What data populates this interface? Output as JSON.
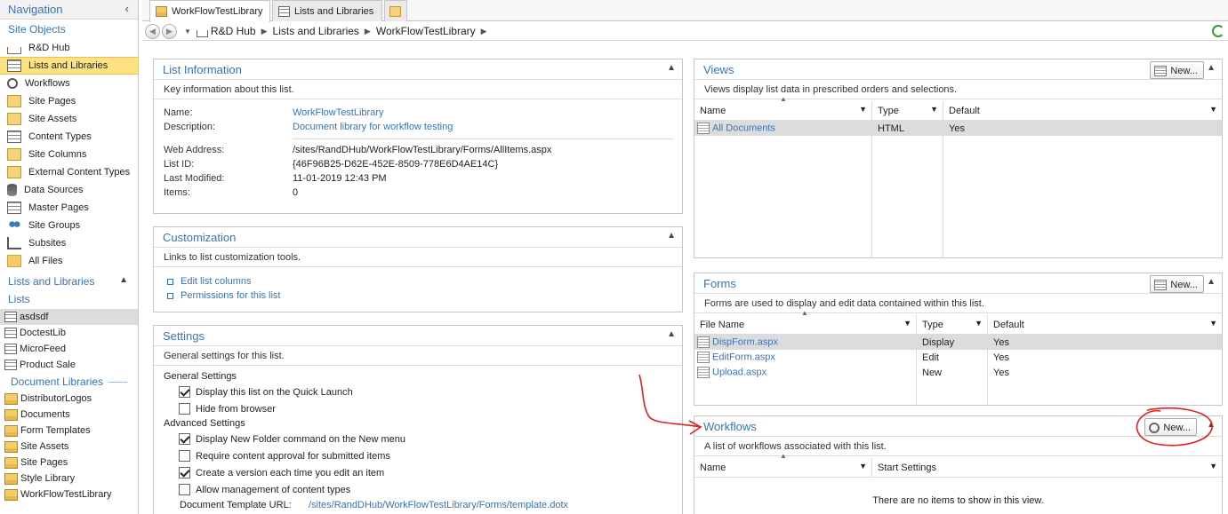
{
  "nav": {
    "title": "Navigation",
    "site_objects_title": "Site Objects",
    "site_objects": [
      {
        "label": "R&D Hub",
        "icon": "house-icon"
      },
      {
        "label": "Lists and Libraries",
        "icon": "list-icon",
        "selected": true
      },
      {
        "label": "Workflows",
        "icon": "workflow-icon"
      },
      {
        "label": "Site Pages",
        "icon": "page-icon"
      },
      {
        "label": "Site Assets",
        "icon": "page-icon"
      },
      {
        "label": "Content Types",
        "icon": "list-icon"
      },
      {
        "label": "Site Columns",
        "icon": "page-icon"
      },
      {
        "label": "External Content Types",
        "icon": "page-icon"
      },
      {
        "label": "Data Sources",
        "icon": "database-icon"
      },
      {
        "label": "Master Pages",
        "icon": "list-icon"
      },
      {
        "label": "Site Groups",
        "icon": "people-icon"
      },
      {
        "label": "Subsites",
        "icon": "tree-icon"
      },
      {
        "label": "All Files",
        "icon": "folder-icon"
      }
    ],
    "lists_libraries_title": "Lists and Libraries",
    "lists_title": "Lists",
    "lists": [
      "asdsdf",
      "DoctestLib",
      "MicroFeed",
      "Product Sale"
    ],
    "doclibs_title": "Document Libraries",
    "doclibs": [
      "DistributorLogos",
      "Documents",
      "Form Templates",
      "Site Assets",
      "Site Pages",
      "Style Library",
      "WorkFlowTestLibrary"
    ]
  },
  "tabs": [
    {
      "label": "WorkFlowTestLibrary",
      "active": true
    },
    {
      "label": "Lists and Libraries",
      "active": false
    }
  ],
  "breadcrumb": [
    "R&D Hub",
    "Lists and Libraries",
    "WorkFlowTestLibrary"
  ],
  "list_info": {
    "title": "List Information",
    "desc": "Key information about this list.",
    "name_label": "Name:",
    "name_value": "WorkFlowTestLibrary",
    "description_label": "Description:",
    "description_value": "Document library for workflow testing",
    "web_address_label": "Web Address:",
    "web_address_value": "/sites/RandDHub/WorkFlowTestLibrary/Forms/AllItems.aspx",
    "list_id_label": "List ID:",
    "list_id_value": "{46F96B25-D62E-452E-8509-778E6D4AE14C}",
    "last_modified_label": "Last Modified:",
    "last_modified_value": "11-01-2019 12:43 PM",
    "items_label": "Items:",
    "items_value": "0"
  },
  "customization": {
    "title": "Customization",
    "desc": "Links to list customization tools.",
    "links": [
      "Edit list columns",
      "Permissions for this list"
    ]
  },
  "settings": {
    "title": "Settings",
    "desc": "General settings for this list.",
    "general_title": "General Settings",
    "general": [
      {
        "label": "Display this list on the Quick Launch",
        "checked": true
      },
      {
        "label": "Hide from browser",
        "checked": false
      }
    ],
    "advanced_title": "Advanced Settings",
    "advanced": [
      {
        "label": "Display New Folder command on the New menu",
        "checked": true
      },
      {
        "label": "Require content approval for submitted items",
        "checked": false
      },
      {
        "label": "Create a version each time you edit an item",
        "checked": true
      },
      {
        "label": "Allow management of content types",
        "checked": false
      }
    ],
    "template_label": "Document Template URL:",
    "template_value": "/sites/RandDHub/WorkFlowTestLibrary/Forms/template.dotx"
  },
  "views": {
    "title": "Views",
    "new_label": "New...",
    "desc": "Views display list data in prescribed orders and selections.",
    "columns": [
      "Name",
      "Type",
      "Default"
    ],
    "rows": [
      {
        "name": "All Documents",
        "type": "HTML",
        "default": "Yes"
      }
    ]
  },
  "forms": {
    "title": "Forms",
    "new_label": "New...",
    "desc": "Forms are used to display and edit data contained within this list.",
    "columns": [
      "File Name",
      "Type",
      "Default"
    ],
    "rows": [
      {
        "name": "DispForm.aspx",
        "type": "Display",
        "default": "Yes"
      },
      {
        "name": "EditForm.aspx",
        "type": "Edit",
        "default": "Yes"
      },
      {
        "name": "Upload.aspx",
        "type": "New",
        "default": "Yes"
      }
    ]
  },
  "workflows": {
    "title": "Workflows",
    "new_label": "New...",
    "desc": "A list of workflows associated with this list.",
    "columns": [
      "Name",
      "Start Settings"
    ],
    "empty": "There are no items to show in this view."
  },
  "colors": {
    "accent": "#3a73b6",
    "selected": "#fde284",
    "annotation": "#e02020"
  }
}
